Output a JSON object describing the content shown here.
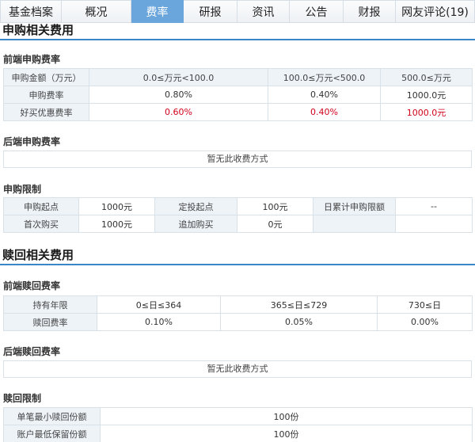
{
  "tabs": [
    {
      "label": "基金档案",
      "active": false
    },
    {
      "label": "概况",
      "active": false
    },
    {
      "label": "费率",
      "active": true
    },
    {
      "label": "研报",
      "active": false
    },
    {
      "label": "资讯",
      "active": false
    },
    {
      "label": "公告",
      "active": false
    },
    {
      "label": "财报",
      "active": false
    },
    {
      "label": "网友评论(19)",
      "active": false
    }
  ],
  "purchase": {
    "title": "申购相关费用",
    "front": {
      "title": "前端申购费率",
      "headers": [
        "申购金额（万元）",
        "0.0≤万元<100.0",
        "100.0≤万元<500.0",
        "500.0≤万元"
      ],
      "rate_row": [
        "申购费率",
        "0.80%",
        "0.40%",
        "1000.0元"
      ],
      "discount_row": [
        "好买优惠费率",
        "0.60%",
        "0.40%",
        "1000.0元"
      ]
    },
    "back": {
      "title": "后端申购费率",
      "empty_text": "暂无此收费方式"
    },
    "limits": {
      "title": "申购限制",
      "row1": [
        "申购起点",
        "1000元",
        "定投起点",
        "100元",
        "日累计申购限额",
        "--"
      ],
      "row2": [
        "首次购买",
        "1000元",
        "追加购买",
        "0元",
        "",
        ""
      ]
    }
  },
  "redeem": {
    "title": "赎回相关费用",
    "front": {
      "title": "前端赎回费率",
      "headers": [
        "持有年限",
        "0≤日≤364",
        "365≤日≤729",
        "730≤日"
      ],
      "rate_row": [
        "赎回费率",
        "0.10%",
        "0.05%",
        "0.00%"
      ]
    },
    "back": {
      "title": "后端赎回费率",
      "empty_text": "暂无此收费方式"
    },
    "limits": {
      "title": "赎回限制",
      "row1": [
        "单笔最小赎回份额",
        "100份"
      ],
      "row2": [
        "账户最低保留份额",
        "100份"
      ]
    }
  },
  "colors": {
    "accent": "#3b86c6",
    "active_tab": "#6aa6dc",
    "highlight_red": "#d0021b",
    "header_cell": "#eef3f8"
  }
}
